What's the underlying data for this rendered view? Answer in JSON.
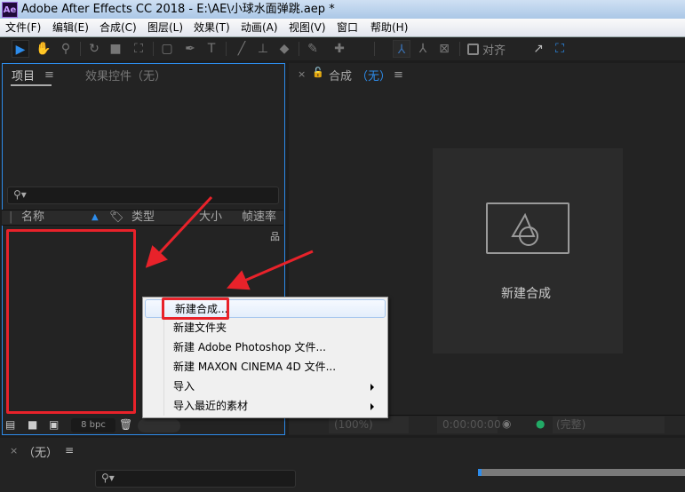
{
  "window": {
    "title": "Adobe After Effects CC 2018 - E:\\AE\\小球水面弹跳.aep *",
    "logo": "Ae"
  },
  "menubar": [
    "文件(F)",
    "编辑(E)",
    "合成(C)",
    "图层(L)",
    "效果(T)",
    "动画(A)",
    "视图(V)",
    "窗口",
    "帮助(H)"
  ],
  "toolbar": {
    "snap_label": "对齐"
  },
  "project_panel": {
    "tab_project": "项目",
    "tab_effects": "效果控件（无）",
    "columns": [
      "名称",
      "类型",
      "大小",
      "帧速率"
    ],
    "bpc": "8 bpc"
  },
  "comp_panel": {
    "tab_label": "合成",
    "tab_value": "（无）",
    "new_comp_label": "新建合成"
  },
  "viewer_bar": {
    "zoom": "(100%)",
    "timecode": "0:00:00:00",
    "resolution": "(完整)"
  },
  "timeline": {
    "tab_label": "（无）"
  },
  "context_menu": {
    "items": [
      {
        "label": "新建合成...",
        "submenu": false
      },
      {
        "label": "新建文件夹",
        "submenu": false
      },
      {
        "label": "新建 Adobe Photoshop 文件...",
        "submenu": false
      },
      {
        "label": "新建 MAXON CINEMA 4D 文件...",
        "submenu": false
      },
      {
        "label": "导入",
        "submenu": true
      },
      {
        "label": "导入最近的素材",
        "submenu": true
      }
    ]
  },
  "colors": {
    "accent": "#2d8ceb",
    "annotation": "#e8222a"
  }
}
